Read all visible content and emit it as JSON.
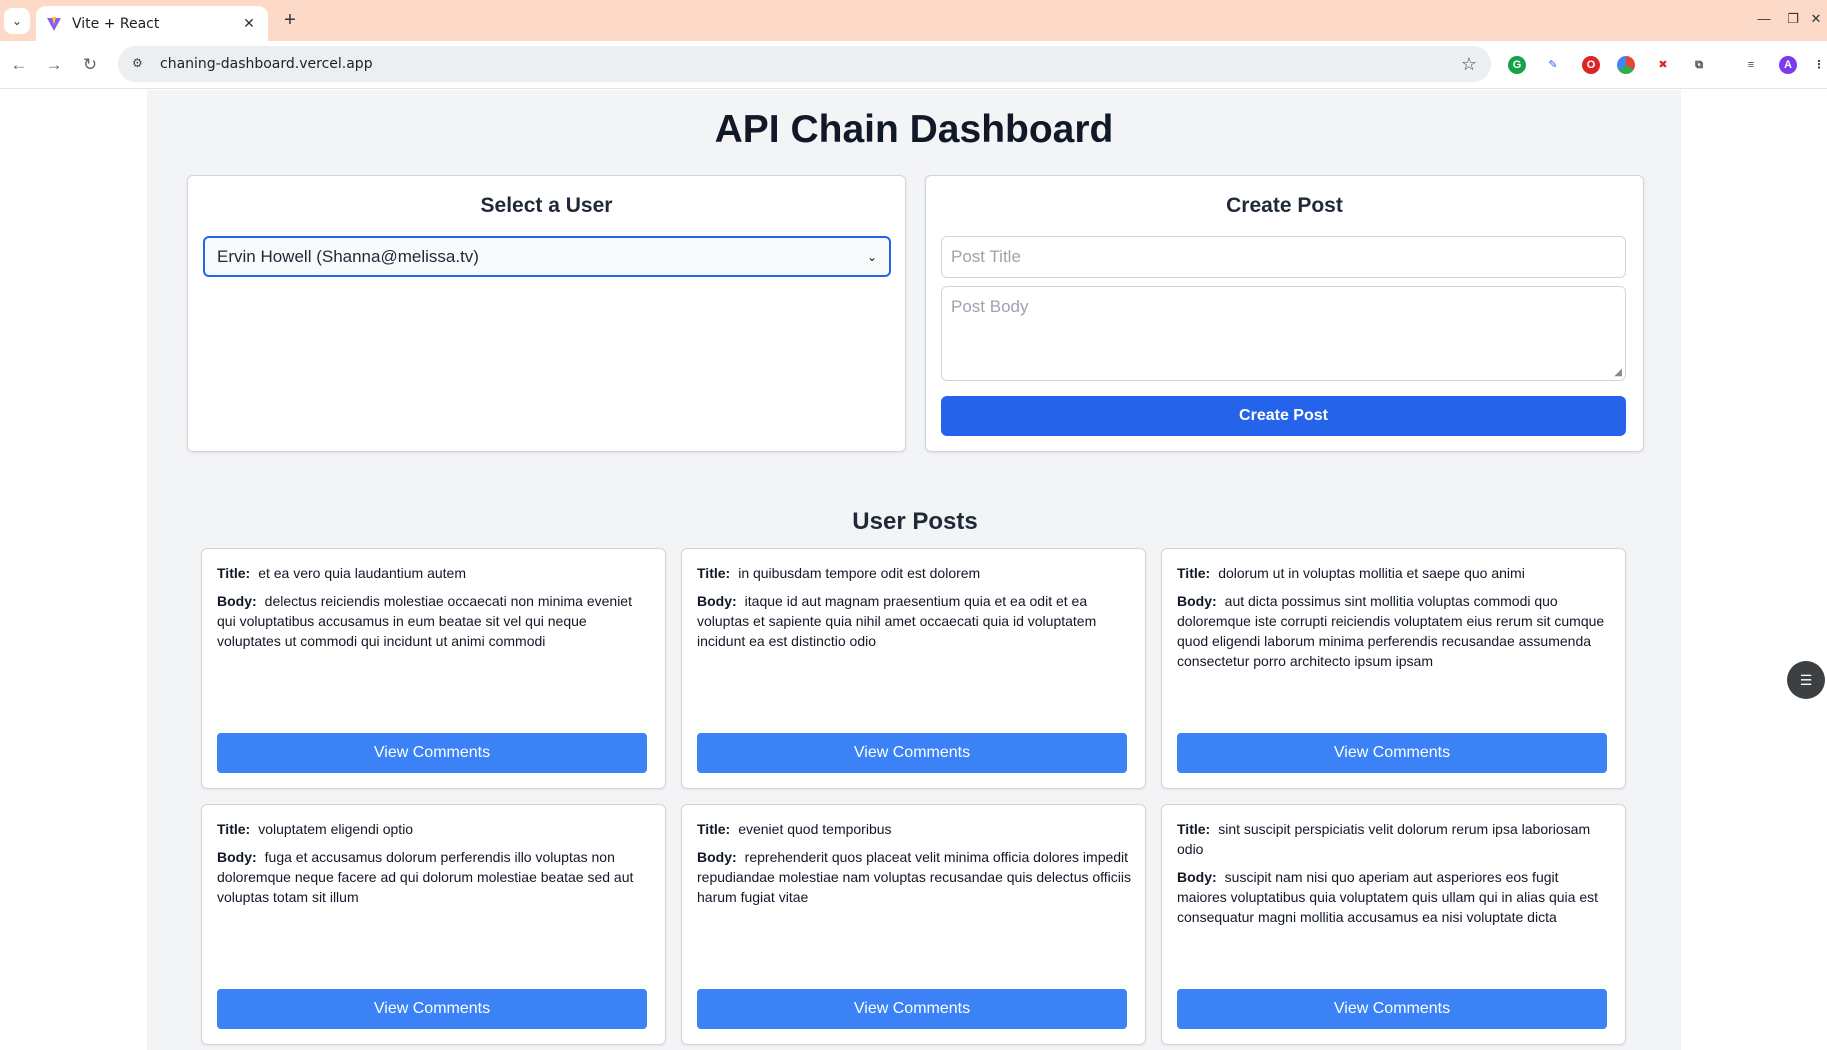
{
  "browser": {
    "tab_title": "Vite + React",
    "url": "chaning-dashboard.vercel.app"
  },
  "page": {
    "title": "API Chain Dashboard"
  },
  "select_user": {
    "heading": "Select a User",
    "selected": "Ervin Howell (Shanna@melissa.tv)"
  },
  "create_post": {
    "heading": "Create Post",
    "title_placeholder": "Post Title",
    "body_placeholder": "Post Body",
    "button": "Create Post"
  },
  "posts": {
    "heading": "User Posts",
    "title_label": "Title:",
    "body_label": "Body:",
    "button_label": "View Comments",
    "items": [
      {
        "title": "et ea vero quia laudantium autem",
        "body": "delectus reiciendis molestiae occaecati non minima eveniet qui voluptatibus accusamus in eum beatae sit vel qui neque voluptates ut commodi qui incidunt ut animi commodi"
      },
      {
        "title": "in quibusdam tempore odit est dolorem",
        "body": "itaque id aut magnam praesentium quia et ea odit et ea voluptas et sapiente quia nihil amet occaecati quia id voluptatem incidunt ea est distinctio odio"
      },
      {
        "title": "dolorum ut in voluptas mollitia et saepe quo animi",
        "body": "aut dicta possimus sint mollitia voluptas commodi quo doloremque iste corrupti reiciendis voluptatem eius rerum sit cumque quod eligendi laborum minima perferendis recusandae assumenda consectetur porro architecto ipsum ipsam"
      },
      {
        "title": "voluptatem eligendi optio",
        "body": "fuga et accusamus dolorum perferendis illo voluptas non doloremque neque facere ad qui dolorum molestiae beatae sed aut voluptas totam sit illum"
      },
      {
        "title": "eveniet quod temporibus",
        "body": "reprehenderit quos placeat velit minima officia dolores impedit repudiandae molestiae nam voluptas recusandae quis delectus officiis harum fugiat vitae"
      },
      {
        "title": "sint suscipit perspiciatis velit dolorum rerum ipsa laboriosam odio",
        "body": "suscipit nam nisi quo aperiam aut asperiores eos fugit maiores voluptatibus quia voluptatem quis ullam qui in alias quia est consequatur magni mollitia accusamus ea nisi voluptate dicta"
      }
    ]
  },
  "colors": {
    "primary_button": "#2563eb",
    "card_button": "#3b82f6",
    "tabstrip": "#fdd9c8",
    "page_bg": "#f3f4f6"
  }
}
